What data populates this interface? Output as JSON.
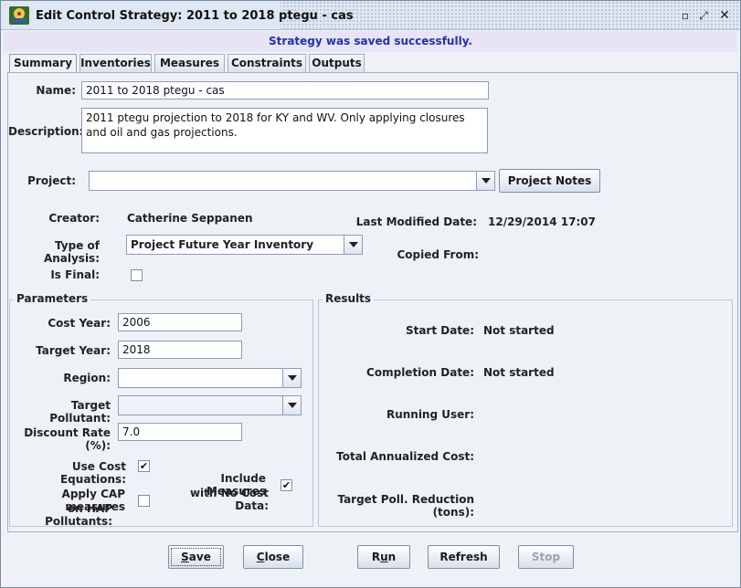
{
  "window": {
    "title": "Edit Control Strategy: 2011 to 2018 ptegu - cas",
    "status_message": "Strategy was saved successfully."
  },
  "tabs": [
    {
      "label": "Summary",
      "active": true
    },
    {
      "label": "Inventories"
    },
    {
      "label": "Measures"
    },
    {
      "label": "Constraints"
    },
    {
      "label": "Outputs"
    }
  ],
  "summary": {
    "name_label": "Name:",
    "name_value": "2011 to 2018 ptegu - cas",
    "description_label": "Description:",
    "description_value": "2011 ptegu projection to 2018 for KY and WV. Only applying closures and oil and gas projections.",
    "project_label": "Project:",
    "project_value": "",
    "project_notes_button": "Project Notes",
    "creator_label": "Creator:",
    "creator_value": "Catherine Seppanen",
    "last_modified_label": "Last Modified Date:",
    "last_modified_value": "12/29/2014 17:07",
    "type_of_analysis_label": "Type of Analysis:",
    "type_of_analysis_value": "Project Future Year Inventory",
    "copied_from_label": "Copied From:",
    "copied_from_value": "",
    "is_final_label": "Is Final:",
    "is_final_checked": false
  },
  "parameters": {
    "title": "Parameters",
    "cost_year_label": "Cost Year:",
    "cost_year_value": "2006",
    "target_year_label": "Target Year:",
    "target_year_value": "2018",
    "region_label": "Region:",
    "region_value": "",
    "target_pollutant_label": "Target Pollutant:",
    "target_pollutant_value": "",
    "discount_rate_label": "Discount Rate (%):",
    "discount_rate_value": "7.0",
    "use_cost_equations_label": "Use Cost Equations:",
    "use_cost_equations_checked": true,
    "apply_cap_label_1": "Apply CAP measures",
    "apply_cap_label_2": "on HAP Pollutants:",
    "apply_cap_checked": false,
    "include_measures_label_1": "Include Measures",
    "include_measures_label_2": "with No Cost Data:",
    "include_measures_checked": true
  },
  "results": {
    "title": "Results",
    "start_date_label": "Start Date:",
    "start_date_value": "Not started",
    "completion_date_label": "Completion Date:",
    "completion_date_value": "Not started",
    "running_user_label": "Running User:",
    "running_user_value": "",
    "total_cost_label": "Total Annualized Cost:",
    "total_cost_value": "",
    "target_reduction_label": "Target Poll. Reduction (tons):",
    "target_reduction_value": ""
  },
  "buttons": {
    "save": {
      "first": "S",
      "rest": "ave"
    },
    "close": {
      "first": "C",
      "rest": "lose"
    },
    "run": {
      "first": "R",
      "mid": "u",
      "rest": "n"
    },
    "refresh": "Refresh",
    "stop": "Stop"
  },
  "icons": {
    "check_glyph": "✔",
    "minimize_glyph": "▫",
    "maximize_glyph": "⤢",
    "close_glyph": "✕"
  }
}
